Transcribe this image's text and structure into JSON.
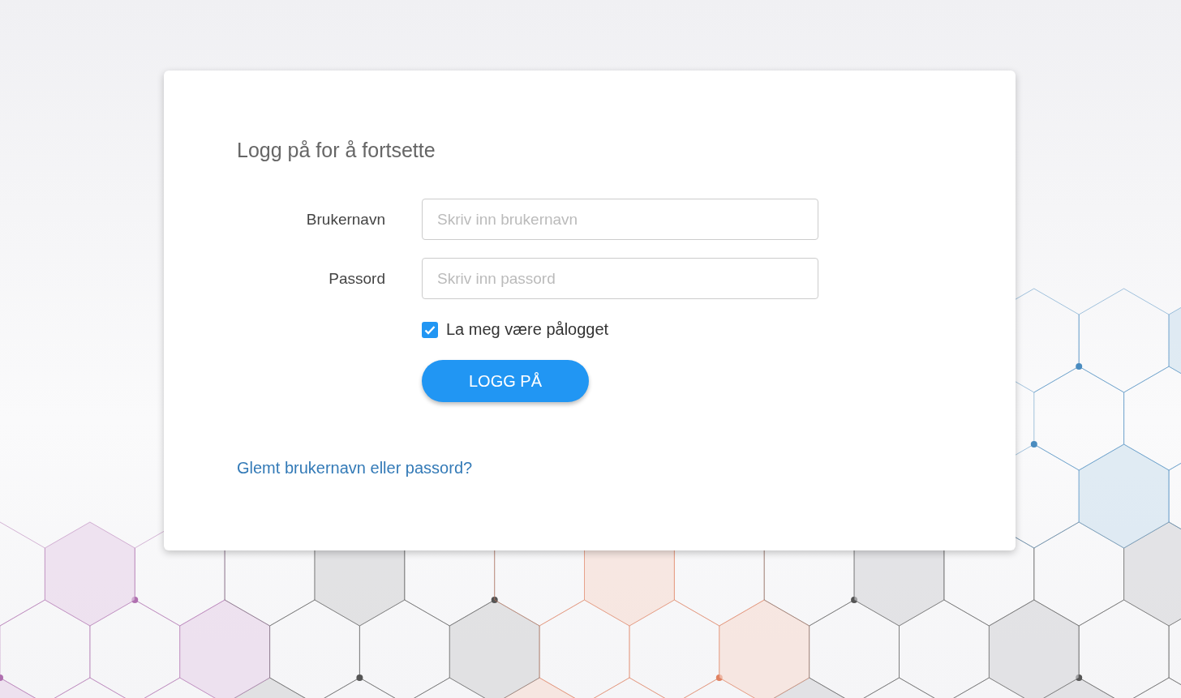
{
  "login": {
    "title": "Logg på for å fortsette",
    "fields": [
      {
        "label": "Brukernavn",
        "placeholder": "Skriv inn brukernavn"
      },
      {
        "label": "Passord",
        "placeholder": "Skriv inn passord"
      }
    ],
    "remember": {
      "label": "La meg være pålogget",
      "checked": true
    },
    "submit": "LOGG PÅ",
    "forgot_link": "Glemt brukernavn eller passord?"
  }
}
